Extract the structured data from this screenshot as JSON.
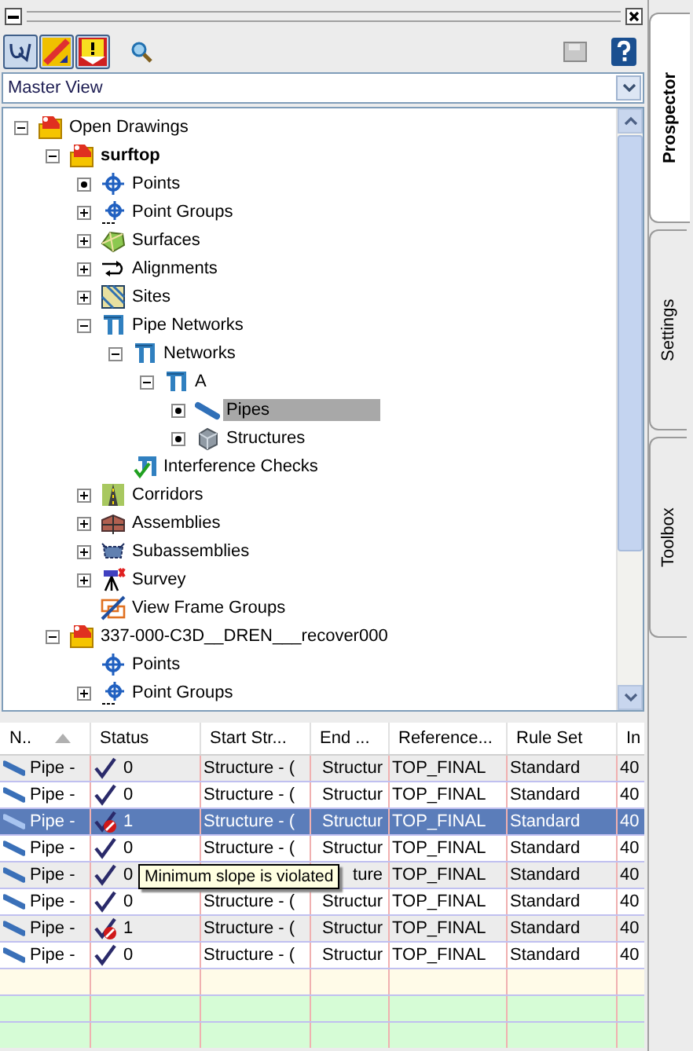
{
  "view_selector": {
    "value": "Master View"
  },
  "tree": [
    {
      "label": "Open Drawings",
      "kind": "drawing",
      "expanded": true,
      "selected": false,
      "children": [
        {
          "label": "surftop",
          "kind": "drawing",
          "expanded": true,
          "bold": true,
          "selected": false,
          "children": [
            {
              "label": "Points",
              "kind": "points",
              "expanded": true,
              "selected": false
            },
            {
              "label": "Point Groups",
              "kind": "pointgroups",
              "expanded": false,
              "selected": false
            },
            {
              "label": "Surfaces",
              "kind": "surfaces",
              "expanded": false,
              "selected": false
            },
            {
              "label": "Alignments",
              "kind": "alignments",
              "expanded": false,
              "selected": false
            },
            {
              "label": "Sites",
              "kind": "sites",
              "expanded": false,
              "selected": false
            },
            {
              "label": "Pipe Networks",
              "kind": "network",
              "expanded": true,
              "selected": false,
              "children": [
                {
                  "label": "Networks",
                  "kind": "network",
                  "expanded": true,
                  "selected": false,
                  "children": [
                    {
                      "label": "A",
                      "kind": "network",
                      "expanded": true,
                      "selected": false,
                      "children": [
                        {
                          "label": "Pipes",
                          "kind": "pipes",
                          "expanded": true,
                          "selected": true
                        },
                        {
                          "label": "Structures",
                          "kind": "structures",
                          "expanded": true,
                          "selected": false
                        }
                      ]
                    }
                  ]
                },
                {
                  "label": "Interference Checks",
                  "kind": "interference",
                  "selected": false
                }
              ]
            },
            {
              "label": "Corridors",
              "kind": "corridors",
              "expanded": false,
              "selected": false
            },
            {
              "label": "Assemblies",
              "kind": "assemblies",
              "expanded": false,
              "selected": false
            },
            {
              "label": "Subassemblies",
              "kind": "subassemblies",
              "expanded": false,
              "selected": false
            },
            {
              "label": "Survey",
              "kind": "survey",
              "expanded": false,
              "selected": false
            },
            {
              "label": "View Frame Groups",
              "kind": "viewframes",
              "selected": false
            }
          ]
        },
        {
          "label": "337-000-C3D__DREN___recover000",
          "kind": "drawing",
          "expanded": true,
          "bold": false,
          "selected": false,
          "children": [
            {
              "label": "Points",
              "kind": "points",
              "selected": false
            },
            {
              "label": "Point Groups",
              "kind": "pointgroups",
              "expanded": false,
              "selected": false
            }
          ]
        }
      ]
    }
  ],
  "table": {
    "columns": [
      {
        "label": "N..",
        "sorted": true
      },
      {
        "label": "Status",
        "sorted": false
      },
      {
        "label": "Start Str...",
        "sorted": false
      },
      {
        "label": "End ...",
        "sorted": false
      },
      {
        "label": "Reference...",
        "sorted": false
      },
      {
        "label": "Rule Set",
        "sorted": false
      },
      {
        "label": "In",
        "sorted": false
      }
    ],
    "rows": [
      {
        "name": "Pipe -",
        "violation": false,
        "status": "0",
        "start": "Structure - (",
        "end": "Structur",
        "reference": "TOP_FINAL",
        "rule_set": "Standard",
        "column_7": "40",
        "selected": false
      },
      {
        "name": "Pipe -",
        "violation": false,
        "status": "0",
        "start": "Structure - (",
        "end": "Structur",
        "reference": "TOP_FINAL",
        "rule_set": "Standard",
        "column_7": "40",
        "selected": false
      },
      {
        "name": "Pipe -",
        "violation": true,
        "status": "1",
        "start": "Structure - (",
        "end": "Structur",
        "reference": "TOP_FINAL",
        "rule_set": "Standard",
        "column_7": "40",
        "selected": true
      },
      {
        "name": "Pipe -",
        "violation": false,
        "status": "0",
        "start": "Structure - (",
        "end": "Structur",
        "reference": "TOP_FINAL",
        "rule_set": "Standard",
        "column_7": "40",
        "selected": false
      },
      {
        "name": "Pipe -",
        "violation": false,
        "status": "0",
        "end": "ture",
        "reference": "TOP_FINAL",
        "rule_set": "Standard",
        "column_7": "40",
        "selected": false
      },
      {
        "name": "Pipe -",
        "violation": false,
        "status": "0",
        "start": "Structure - (",
        "end": "Structur",
        "reference": "TOP_FINAL",
        "rule_set": "Standard",
        "column_7": "40",
        "selected": false
      },
      {
        "name": "Pipe -",
        "violation": true,
        "status": "1",
        "start": "Structure - (",
        "end": "Structur",
        "reference": "TOP_FINAL",
        "rule_set": "Standard",
        "column_7": "40",
        "selected": false
      },
      {
        "name": "Pipe -",
        "violation": false,
        "status": "0",
        "start": "Structure - (",
        "end": "Structur",
        "reference": "TOP_FINAL",
        "rule_set": "Standard",
        "column_7": "40",
        "selected": false
      }
    ]
  },
  "tooltip": "Minimum slope is violated",
  "side_tabs": [
    {
      "label": "Prospector",
      "selected": true
    },
    {
      "label": "Settings",
      "selected": false
    },
    {
      "label": "Toolbox",
      "selected": false
    }
  ]
}
